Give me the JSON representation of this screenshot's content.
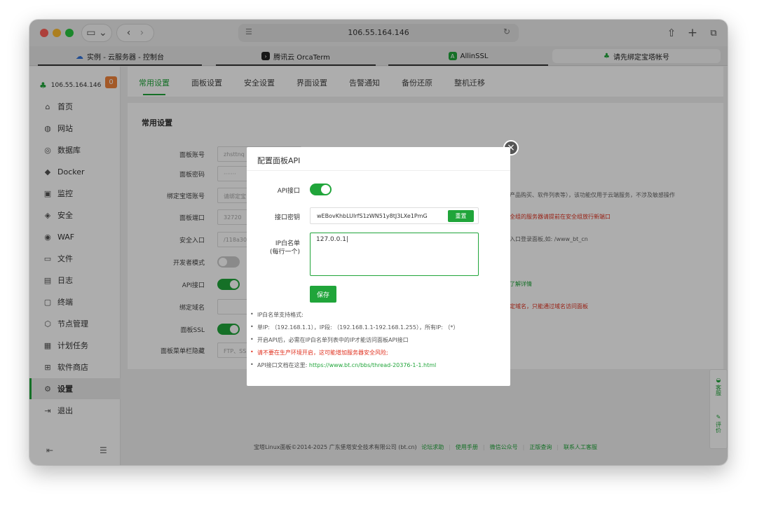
{
  "browser": {
    "url": "106.55.164.146",
    "tabs": [
      {
        "label": "实例 - 云服务器 - 控制台"
      },
      {
        "label": "腾讯云 OrcaTerm"
      },
      {
        "label": "AllinSSL"
      },
      {
        "label": "请先绑定宝塔帐号"
      }
    ]
  },
  "sidebar": {
    "host": "106.55.164.146",
    "badge": "0",
    "items": [
      {
        "label": "首页",
        "icon": "home-icon"
      },
      {
        "label": "网站",
        "icon": "globe-icon"
      },
      {
        "label": "数据库",
        "icon": "database-icon"
      },
      {
        "label": "Docker",
        "icon": "docker-icon"
      },
      {
        "label": "监控",
        "icon": "monitor-icon"
      },
      {
        "label": "安全",
        "icon": "shield-icon"
      },
      {
        "label": "WAF",
        "icon": "waf-icon"
      },
      {
        "label": "文件",
        "icon": "folder-icon"
      },
      {
        "label": "日志",
        "icon": "log-icon"
      },
      {
        "label": "终端",
        "icon": "terminal-icon"
      },
      {
        "label": "节点管理",
        "icon": "node-icon"
      },
      {
        "label": "计划任务",
        "icon": "calendar-icon"
      },
      {
        "label": "软件商店",
        "icon": "grid-icon"
      },
      {
        "label": "设置",
        "icon": "gear-icon"
      },
      {
        "label": "退出",
        "icon": "logout-icon"
      }
    ]
  },
  "topnav": [
    "常用设置",
    "面板设置",
    "安全设置",
    "界面设置",
    "告警通知",
    "备份还原",
    "整机迁移"
  ],
  "panel": {
    "title": "常用设置",
    "rows": [
      {
        "label": "面板账号",
        "value": "zhsttnq"
      },
      {
        "label": "面板密码",
        "value": "·······"
      },
      {
        "label": "绑定宝塔账号",
        "value": "请绑定宝",
        "note": "产品购买、软件列表等），该功能仅用于云端服务，不涉及敏感操作"
      },
      {
        "label": "面板端口",
        "value": "32720",
        "note": "全组的服务器请提前在安全组放行新端口"
      },
      {
        "label": "安全入口",
        "value": "/118a30",
        "note": "入口登录面板,如: /www_bt_cn"
      },
      {
        "label": "开发者模式"
      },
      {
        "label": "API接口",
        "note": "了解详情"
      },
      {
        "label": "绑定域名",
        "note": "定域名，只能通过域名访问面板"
      },
      {
        "label": "面板SSL"
      },
      {
        "label": "面板菜单栏隐藏",
        "value": "FTP、SS"
      }
    ]
  },
  "footer": {
    "copyright": "宝塔Linux面板©2014-2025 广东堡塔安全技术有限公司 (bt.cn)",
    "links": [
      "论坛求助",
      "使用手册",
      "微信公众号",
      "正版查询",
      "联系人工客服"
    ]
  },
  "side_help": {
    "service": "客服",
    "rate": "评价"
  },
  "modal": {
    "title": "配置面板API",
    "api_label": "API接口",
    "api_enabled": true,
    "key_label": "接口密钥",
    "key_value": "wEBovKhbLUIrfS1zWN51y8tJ3LXe1PmG",
    "reset_label": "重置",
    "whitelist_label": "IP白名单",
    "whitelist_sub": "(每行一个)",
    "whitelist_value": "127.0.0.1",
    "save_label": "保存",
    "tips": [
      "IP白名单支持格式:",
      "单IP: （192.168.1.1），IP段: （192.168.1.1-192.168.1.255），所有IP: （*）",
      "开启API后，必需在IP白名单列表中的IP才能访问面板API接口",
      "请不要在生产环境开启，这可能增加服务器安全风险;"
    ],
    "doc_prefix": "API接口文档在这里: ",
    "doc_link": "https://www.bt.cn/bbs/thread-20376-1-1.html"
  },
  "colors": {
    "accent": "#20a53a",
    "danger": "#e0311f",
    "badge": "#f0843b"
  }
}
